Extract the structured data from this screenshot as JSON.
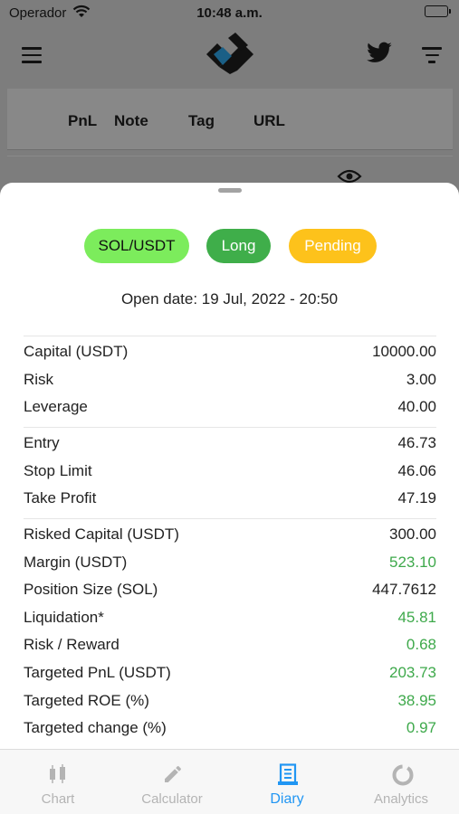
{
  "status_bar": {
    "carrier": "Operador",
    "time": "10:48 a.m."
  },
  "background": {
    "columns": [
      "PnL",
      "Note",
      "Tag",
      "URL"
    ]
  },
  "trade": {
    "pair": "SOL/USDT",
    "direction": "Long",
    "status": "Pending",
    "open_date": "Open date: 19 Jul, 2022 - 20:50"
  },
  "sections": {
    "inputs": [
      {
        "label": "Capital (USDT)",
        "value": "10000.00"
      },
      {
        "label": "Risk",
        "value": "3.00"
      },
      {
        "label": "Leverage",
        "value": "40.00"
      }
    ],
    "levels": [
      {
        "label": "Entry",
        "value": "46.73"
      },
      {
        "label": "Stop Limit",
        "value": "46.06"
      },
      {
        "label": "Take Profit",
        "value": "47.19"
      }
    ],
    "results": [
      {
        "label": "Risked Capital (USDT)",
        "value": "300.00",
        "color": "#222222"
      },
      {
        "label": "Margin (USDT)",
        "value": "523.10",
        "color": "#3ea94b"
      },
      {
        "label": "Position Size (SOL)",
        "value": "447.7612",
        "color": "#222222"
      },
      {
        "label": "Liquidation*",
        "value": "45.81",
        "color": "#3ea94b"
      },
      {
        "label": "Risk / Reward",
        "value": "0.68",
        "color": "#3ea94b"
      },
      {
        "label": "Targeted PnL (USDT)",
        "value": "203.73",
        "color": "#3ea94b"
      },
      {
        "label": "Targeted ROE (%)",
        "value": "38.95",
        "color": "#3ea94b"
      },
      {
        "label": "Targeted change (%)",
        "value": "0.97",
        "color": "#3ea94b"
      }
    ]
  },
  "tabs": [
    {
      "label": "Chart",
      "icon": "candlestick-icon",
      "active": false
    },
    {
      "label": "Calculator",
      "icon": "pencil-icon",
      "active": false
    },
    {
      "label": "Diary",
      "icon": "receipt-icon",
      "active": true
    },
    {
      "label": "Analytics",
      "icon": "donut-icon",
      "active": false
    }
  ],
  "colors": {
    "accent": "#2196f3",
    "pair_pill": "#7cec5c",
    "long_pill": "#3fae4a",
    "pending_pill": "#fdc21b",
    "positive": "#3ea94b"
  }
}
